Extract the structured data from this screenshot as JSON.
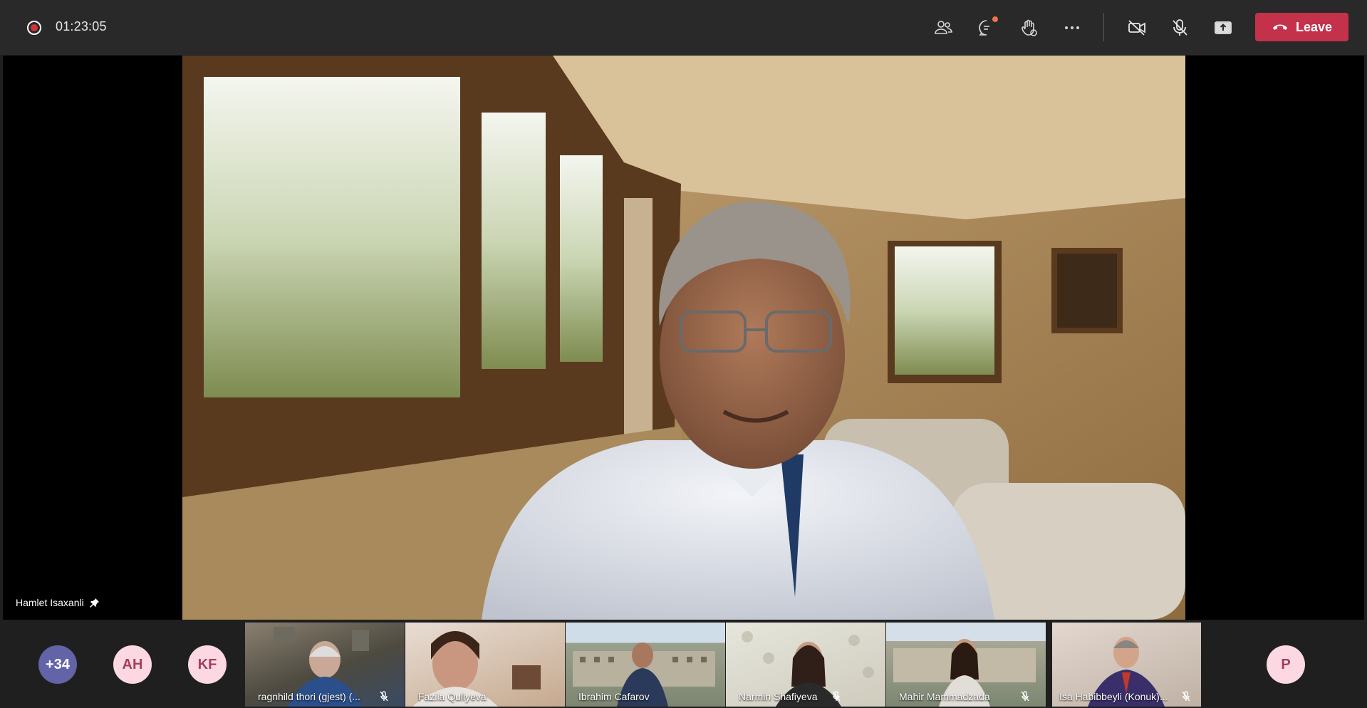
{
  "toolbar": {
    "timer": "01:23:05",
    "leave_label": "Leave"
  },
  "stage": {
    "pinned_name": "Hamlet Isaxanli"
  },
  "participants": {
    "overflow": "+34",
    "avatars": [
      "AH",
      "KF",
      "P"
    ],
    "tiles": [
      {
        "name": "ragnhild thori (gjest) (..."
      },
      {
        "name": "Fazila Quliyeva"
      },
      {
        "name": "Ibrahim Cafarov"
      },
      {
        "name": "Narmin Shafiyeva"
      },
      {
        "name": "Mahir Mammadzada"
      },
      {
        "name": "Isa Habibbeyli (Konuk)..."
      }
    ]
  },
  "colors": {
    "leave": "#c4314b",
    "recording": "#d13438",
    "avatar_overflow": "#6264a7",
    "avatar_initials_bg": "#fbd8e2",
    "notification": "#e97548"
  }
}
